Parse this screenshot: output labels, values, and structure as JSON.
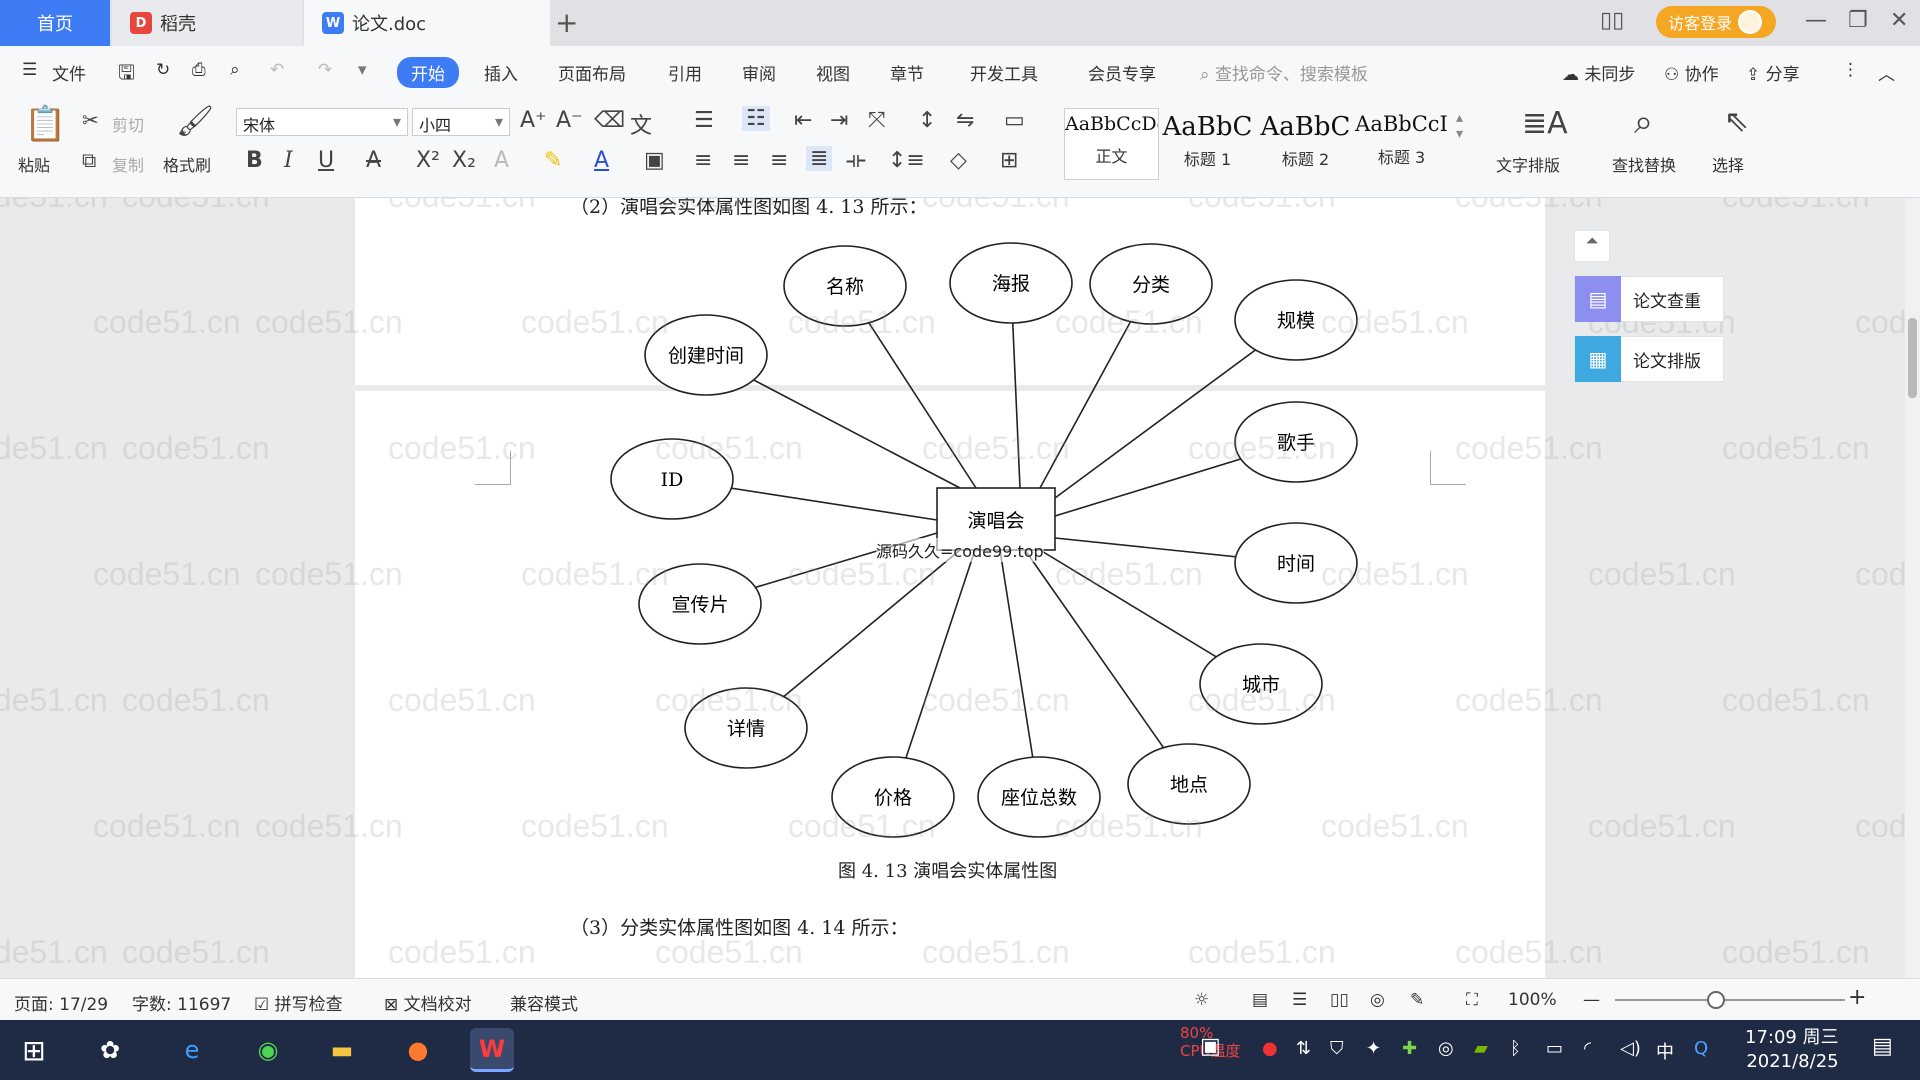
{
  "tabs": {
    "home": "首页",
    "daoke": "稻壳",
    "doc": "论文.doc"
  },
  "titlebar": {
    "login": "访客登录"
  },
  "menu": {
    "file": "文件",
    "items": [
      "开始",
      "插入",
      "页面布局",
      "引用",
      "审阅",
      "视图",
      "章节",
      "开发工具",
      "会员专享"
    ],
    "search_placeholder": "查找命令、搜索模板",
    "sync": "未同步",
    "collab": "协作",
    "share": "分享"
  },
  "ribbon": {
    "paste": "粘贴",
    "cut": "剪切",
    "copy": "复制",
    "format_painter": "格式刷",
    "font_name": "宋体",
    "font_size": "小四",
    "styles": [
      {
        "preview": "AaBbCcDd",
        "name": "正文"
      },
      {
        "preview": "AaBbC",
        "name": "标题 1"
      },
      {
        "preview": "AaBbC",
        "name": "标题 2"
      },
      {
        "preview": "AaBbCcI",
        "name": "标题 3"
      }
    ],
    "text_layout": "文字排版",
    "find_replace": "查找替换",
    "select": "选择"
  },
  "document": {
    "para1": "（2）演唱会实体属性图如图 4. 13 所示：",
    "caption": "图 4. 13   演唱会实体属性图",
    "para2": "（3）分类实体属性图如图 4. 14 所示：",
    "source_note": "源码久久=code99.top",
    "watermark": "code51.cn"
  },
  "diagram": {
    "entity": "演唱会",
    "attributes": [
      "名称",
      "海报",
      "分类",
      "规模",
      "创建时间",
      "歌手",
      "ID",
      "时间",
      "宣传片",
      "城市",
      "详情",
      "价格",
      "座位总数",
      "地点"
    ]
  },
  "side_panel": {
    "check": "论文查重",
    "layout": "论文排版"
  },
  "status": {
    "page": "页面: 17/29",
    "words": "字数: 11697",
    "spell": "拼写检查",
    "proof": "文档校对",
    "compat": "兼容模式",
    "zoom": "100%"
  },
  "taskbar": {
    "cpu_pct": "80%",
    "cpu_label": "CPU温度",
    "ime": "中",
    "time": "17:09 周三",
    "date": "2021/8/25"
  },
  "colors": {
    "accent": "#3d7cf4",
    "login": "#f5a623",
    "taskbar": "#1f2a44"
  }
}
